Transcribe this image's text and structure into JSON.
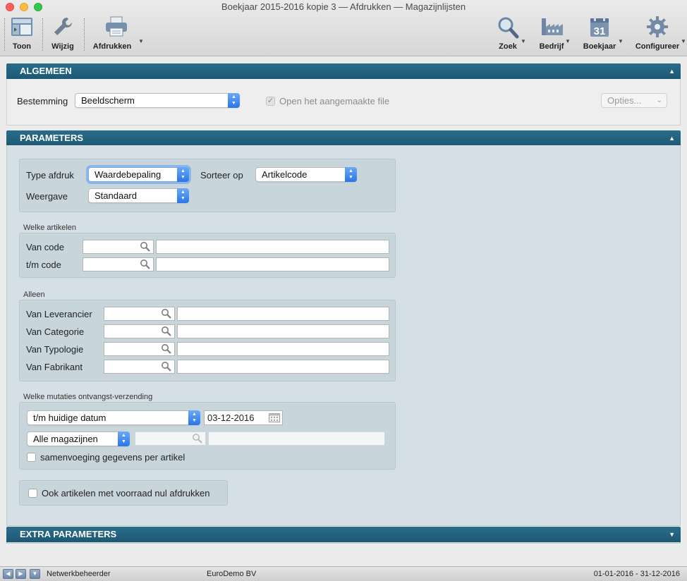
{
  "window": {
    "title": "Boekjaar 2015-2016 kopie 3 — Afdrukken — Magazijnlijsten"
  },
  "toolbar": {
    "toon": "Toon",
    "wijzig": "Wijzig",
    "afdrukken": "Afdrukken",
    "zoek": "Zoek",
    "bedrijf": "Bedrijf",
    "boekjaar": "Boekjaar",
    "boekjaar_day": "31",
    "configureer": "Configureer"
  },
  "algemeen": {
    "title": "ALGEMEEN",
    "bestemming_label": "Bestemming",
    "bestemming_value": "Beeldscherm",
    "open_file_label": "Open het aangemaakte file",
    "opties_label": "Opties..."
  },
  "parameters": {
    "title": "PARAMETERS",
    "type_afdruk_label": "Type afdruk",
    "type_afdruk_value": "Waardebepaling",
    "sorteer_op_label": "Sorteer op",
    "sorteer_op_value": "Artikelcode",
    "weergave_label": "Weergave",
    "weergave_value": "Standaard",
    "welke_artikelen": {
      "title": "Welke artikelen",
      "van_code": "Van code",
      "tm_code": "t/m code"
    },
    "alleen": {
      "title": "Alleen",
      "rows": [
        "Van Leverancier",
        "Van Categorie",
        "Van Typologie",
        "Van Fabrikant"
      ]
    },
    "mutaties": {
      "title": "Welke mutaties ontvangst-verzending",
      "period_value": "t/m huidige datum",
      "date_value": "03-12-2016",
      "magazijnen_value": "Alle magazijnen",
      "samenvoeging_label": "samenvoeging gegevens per artikel"
    },
    "voorraad_nul_label": "Ook artikelen met voorraad nul afdrukken"
  },
  "extra_parameters": {
    "title": "EXTRA PARAMETERS"
  },
  "status": {
    "user": "Netwerkbeheerder",
    "company": "EuroDemo BV",
    "period": "01-01-2016 - 31-12-2016"
  }
}
